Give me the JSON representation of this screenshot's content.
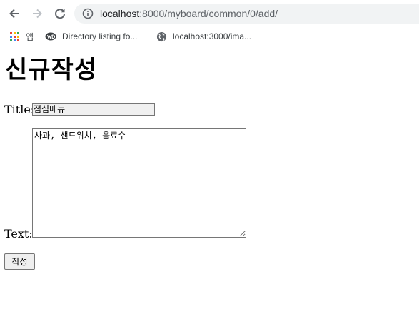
{
  "browser": {
    "url_host": "localhost",
    "url_path": ":8000/myboard/common/0/add/",
    "bookmarks": [
      {
        "label": "앱",
        "icon": "apps-grid-icon"
      },
      {
        "label": "Directory listing fo...",
        "icon": "wd-logo-icon"
      },
      {
        "label": "localhost:3000/ima...",
        "icon": "globe-icon"
      }
    ]
  },
  "page": {
    "heading": "신규작성",
    "title_label": "Title:",
    "title_value": "점심메뉴",
    "text_label": "Text:",
    "text_value": "사과, 샌드위치, 음료수",
    "submit_label": "작성"
  }
}
